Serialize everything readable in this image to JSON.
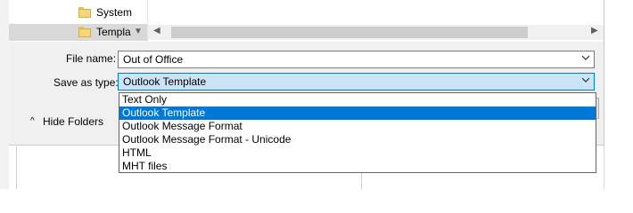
{
  "file_list": {
    "folders": [
      {
        "label": "System",
        "selected": false
      },
      {
        "label": "Templa",
        "selected": true
      }
    ]
  },
  "form": {
    "file_name_label": "File name:",
    "file_name_value": "Out of Office",
    "save_type_label": "Save as type:",
    "save_type_value": "Outlook Template"
  },
  "hide_folders_label": "Hide Folders",
  "save_type_options": [
    {
      "label": "Text Only",
      "highlighted": false
    },
    {
      "label": "Outlook Template",
      "highlighted": true
    },
    {
      "label": "Outlook Message Format",
      "highlighted": false
    },
    {
      "label": "Outlook Message Format - Unicode",
      "highlighted": false
    },
    {
      "label": "HTML",
      "highlighted": false
    },
    {
      "label": "MHT files",
      "highlighted": false
    }
  ],
  "colors": {
    "accent": "#0078d7",
    "selection_fill": "#cce4f7",
    "dialog_bg": "#f0f0f0",
    "folder": "#f5d67a"
  }
}
